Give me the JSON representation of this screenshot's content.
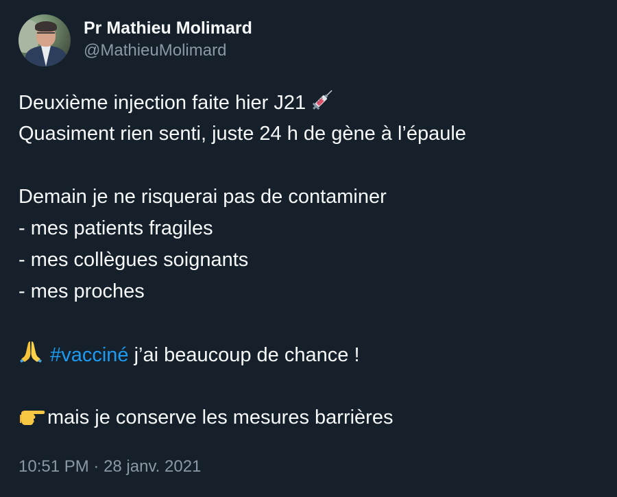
{
  "author": {
    "display_name": "Pr Mathieu Molimard",
    "handle": "@MathieuMolimard"
  },
  "tweet": {
    "line1_text": "Deuxième injection faite hier J21",
    "line1_icon": "syringe-emoji",
    "line2": "Quasiment rien senti, juste 24 h de gène à l’épaule",
    "line3": "Demain je ne risquerai pas de contaminer",
    "line4": "- mes patients fragiles",
    "line5": "- mes collègues soignants",
    "line6": "- mes proches",
    "line7_icon": "folded-hands-emoji",
    "hashtag": "#vacciné",
    "line7_rest": " j’ai beaucoup de chance !",
    "line8_icon": "pointing-right-emoji",
    "line8_text": "mais je conserve les mesures barrières"
  },
  "meta": {
    "time": "10:51 PM",
    "separator": " · ",
    "date": "28 janv. 2021"
  },
  "colors": {
    "background": "#15202b",
    "text": "#f7f9f9",
    "secondary": "#8b98a5",
    "link": "#1d9bf0"
  }
}
